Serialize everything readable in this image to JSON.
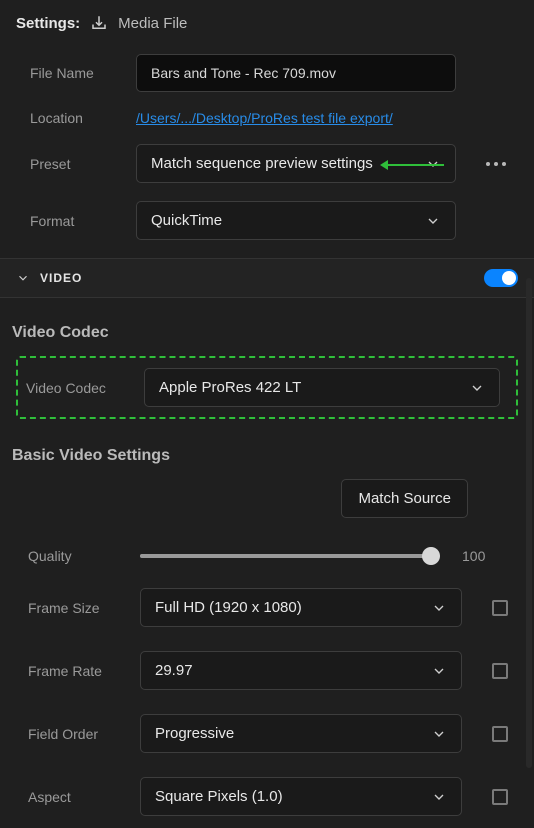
{
  "header": {
    "settings_label": "Settings:",
    "media_file_label": "Media File"
  },
  "form": {
    "filename_label": "File Name",
    "filename_value": "Bars and Tone - Rec 709.mov",
    "location_label": "Location",
    "location_value": "/Users/.../Desktop/ProRes test file export/",
    "preset_label": "Preset",
    "preset_value": "Match sequence preview settings",
    "format_label": "Format",
    "format_value": "QuickTime"
  },
  "video_section": {
    "title": "VIDEO",
    "codec_heading": "Video Codec",
    "codec_label": "Video Codec",
    "codec_value": "Apple ProRes 422 LT",
    "basic_heading": "Basic Video Settings",
    "match_source_label": "Match Source",
    "quality_label": "Quality",
    "quality_value": "100",
    "frame_size_label": "Frame Size",
    "frame_size_value": "Full HD (1920 x 1080)",
    "frame_rate_label": "Frame Rate",
    "frame_rate_value": "29.97",
    "field_order_label": "Field Order",
    "field_order_value": "Progressive",
    "aspect_label": "Aspect",
    "aspect_value": "Square Pixels (1.0)"
  }
}
